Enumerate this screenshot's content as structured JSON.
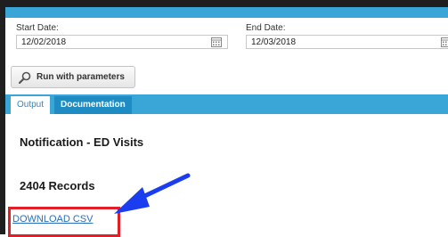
{
  "form": {
    "start_label": "Start Date:",
    "start_value": "12/02/2018",
    "end_label": "End Date:",
    "end_value": "12/03/2018",
    "calendar_icon": "calendar-icon"
  },
  "run_button": {
    "label": "Run with parameters",
    "icon": "magnifier-icon"
  },
  "tabs": [
    {
      "label": "Output",
      "selected": true
    },
    {
      "label": "Documentation",
      "selected": false
    }
  ],
  "report": {
    "title": "Notification - ED Visits",
    "record_count": "2404 Records",
    "download_label": "DOWNLOAD CSV"
  },
  "annotation": {
    "arrow_color": "#1a3df0",
    "box_color": "#e21e26"
  },
  "colors": {
    "accent": "#3aa6d8",
    "tab_dark": "#1f8bc3"
  }
}
